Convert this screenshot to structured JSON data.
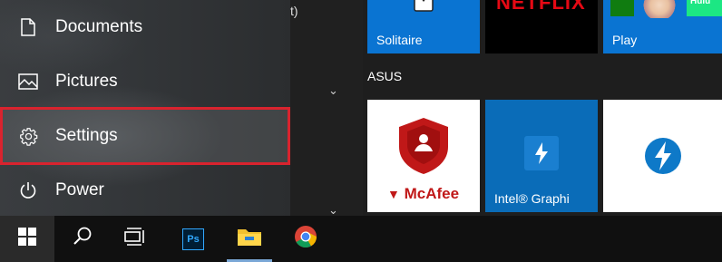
{
  "start_menu": {
    "power_items": [
      {
        "label": "Documents",
        "icon": "document-icon"
      },
      {
        "label": "Pictures",
        "icon": "pictures-icon"
      },
      {
        "label": "Settings",
        "icon": "gear-icon"
      },
      {
        "label": "Power",
        "icon": "power-icon"
      }
    ],
    "highlight_color": "#d9232e",
    "app_list_fragment": "t)"
  },
  "tiles": {
    "group_label": "ASUS",
    "items": [
      {
        "label": "Solitaire",
        "color": "#0a74d2"
      },
      {
        "label": "NETFLIX",
        "color": "#000000"
      },
      {
        "label": "Play",
        "color": "#0a74d2"
      },
      {
        "label": "McAfee",
        "color": "#ffffff"
      },
      {
        "label": "Intel® Graphi",
        "color": "#0a6cb8"
      },
      {
        "label": "",
        "color": "#ffffff"
      }
    ],
    "play_tile_badge": "Hulu"
  },
  "taskbar": {
    "items": [
      "start-button",
      "search-button",
      "task-view-button",
      "photoshop-app",
      "file-explorer-app",
      "chrome-app"
    ],
    "ps_label": "Ps"
  }
}
